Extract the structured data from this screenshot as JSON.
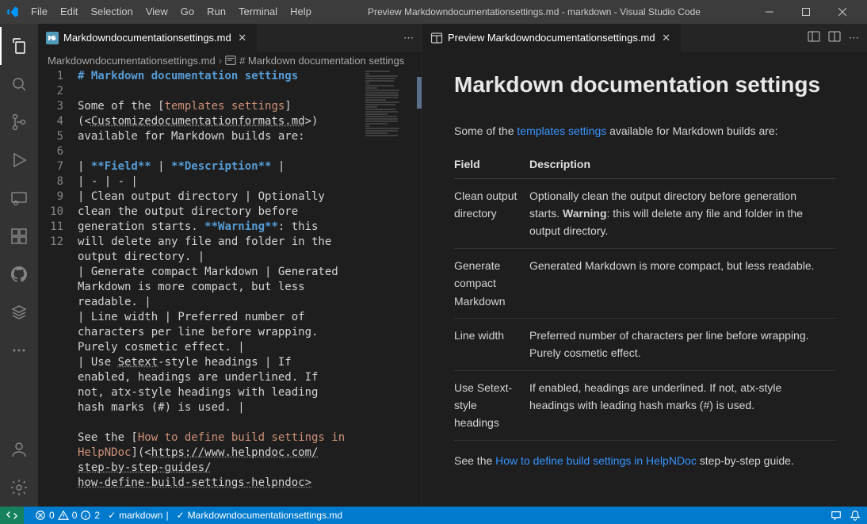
{
  "titlebar": {
    "menu": [
      "File",
      "Edit",
      "Selection",
      "View",
      "Go",
      "Run",
      "Terminal",
      "Help"
    ],
    "title": "Preview Markdowndocumentationsettings.md - markdown - Visual Studio Code"
  },
  "editor_tab": {
    "filename": "Markdowndocumentationsettings.md"
  },
  "preview_tab": {
    "filename": "Preview Markdowndocumentationsettings.md"
  },
  "breadcrumb": {
    "file": "Markdowndocumentationsettings.md",
    "section": "# Markdown documentation settings"
  },
  "code": {
    "line_numbers": [
      "1",
      "2",
      "3",
      "",
      "",
      "4",
      "5",
      "6",
      "7",
      "",
      "",
      "",
      "",
      "8",
      "",
      "",
      "9",
      "",
      "",
      "10",
      "",
      "",
      "",
      "11",
      "12",
      "",
      "",
      ""
    ],
    "l1": "# Markdown documentation settings",
    "l3_a": "Some of the [",
    "l3_b": "templates settings",
    "l3_c": "]",
    "l3d_a": "(<",
    "l3d_b": "Customizedocumentationformats.md",
    "l3d_c": ">) ",
    "l3e": "available for Markdown builds are:",
    "l5_a": "| ",
    "l5_b": "**Field**",
    "l5_c": " | ",
    "l5_d": "**Description**",
    "l5_e": " |",
    "l6": "| - | - |",
    "l7a": "| Clean output directory | Optionally ",
    "l7b": "clean the output directory before ",
    "l7c_a": "generation starts. ",
    "l7c_b": "**Warning**",
    "l7c_c": ": this ",
    "l7d": "will delete any file and folder in the ",
    "l7e": "output directory. |",
    "l8a": "| Generate compact Markdown | Generated ",
    "l8b": "Markdown is more compact, but less ",
    "l8c": "readable. |",
    "l9a": "| Line width | Preferred number of ",
    "l9b": "characters per line before wrapping. ",
    "l9c": "Purely cosmetic effect. |",
    "l10a_a": "| Use ",
    "l10a_b": "Setext",
    "l10a_c": "-style headings | If ",
    "l10b": "enabled, headings are underlined. If ",
    "l10c": "not, atx-style headings with leading ",
    "l10d": "hash marks (#) is used. |",
    "l12a_a": "See the [",
    "l12a_b": "How to define build settings in ",
    "l12b_a": "HelpNDoc",
    "l12b_b": "](<",
    "l12b_c": "https://www.helpndoc.com/",
    "l12c": "step-by-step-guides/",
    "l12d": "how-define-build-settings-helpndoc>"
  },
  "preview": {
    "heading": "Markdown documentation settings",
    "intro_a": "Some of the ",
    "intro_link": "templates settings",
    "intro_b": " available for Markdown builds are:",
    "th1": "Field",
    "th2": "Description",
    "rows": [
      {
        "field": "Clean output directory",
        "desc_a": "Optionally clean the output directory before generation starts. ",
        "desc_bold": "Warning",
        "desc_b": ": this will delete any file and folder in the output directory."
      },
      {
        "field": "Generate compact Markdown",
        "desc_a": "Generated Markdown is more compact, but less readable.",
        "desc_bold": "",
        "desc_b": ""
      },
      {
        "field": "Line width",
        "desc_a": "Preferred number of characters per line before wrapping. Purely cosmetic effect.",
        "desc_bold": "",
        "desc_b": ""
      },
      {
        "field": "Use Setext-style headings",
        "desc_a": "If enabled, headings are underlined. If not, atx-style headings with leading hash marks (#) is used.",
        "desc_bold": "",
        "desc_b": ""
      }
    ],
    "footer_a": "See the ",
    "footer_link": "How to define build settings in HelpNDoc",
    "footer_b": " step-by-step guide."
  },
  "statusbar": {
    "errors": "0",
    "warnings": "0",
    "info": "2",
    "lang": "markdown",
    "filecheck": "Markdowndocumentationsettings.md"
  }
}
